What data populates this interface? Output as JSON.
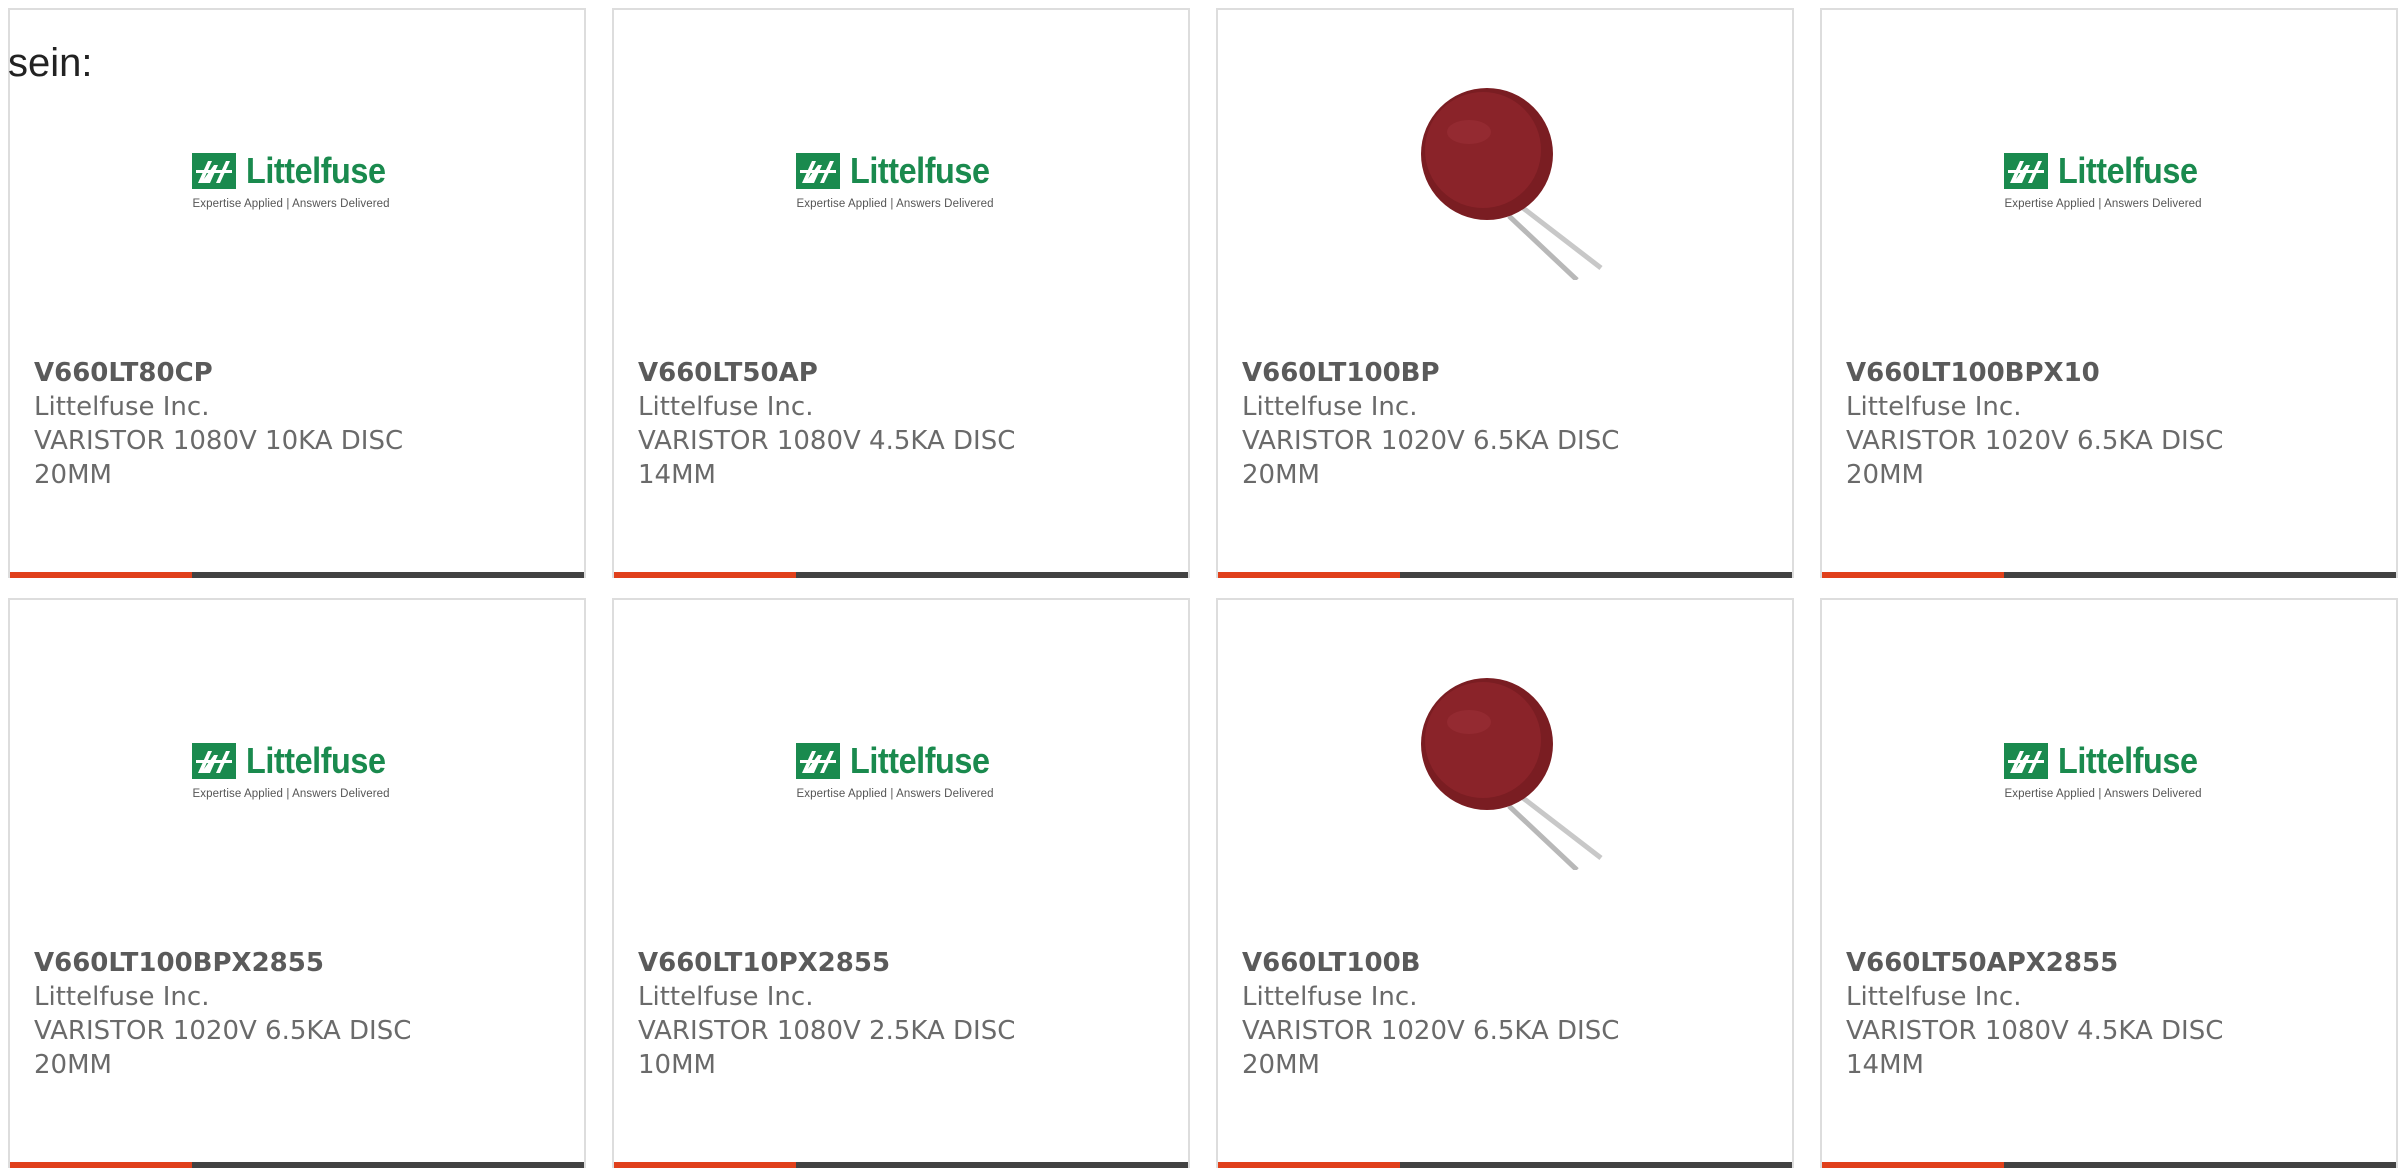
{
  "intro_text": "sein:",
  "logo": {
    "wordmark": "Littelfuse",
    "tagline": "Expertise Applied | Answers Delivered",
    "brand_color": "#1a8a4e"
  },
  "colors": {
    "accent_bar": "#e0401b",
    "bar": "#424242"
  },
  "products": [
    {
      "part": "V660LT80CP",
      "manufacturer": "Littelfuse Inc.",
      "description": "VARISTOR 1080V 10KA DISC 20MM",
      "image": "littelfuse-logo"
    },
    {
      "part": "V660LT50AP",
      "manufacturer": "Littelfuse Inc.",
      "description": "VARISTOR 1080V 4.5KA DISC 14MM",
      "image": "littelfuse-logo"
    },
    {
      "part": "V660LT100BP",
      "manufacturer": "Littelfuse Inc.",
      "description": "VARISTOR 1020V 6.5KA DISC 20MM",
      "image": "varistor-disc-photo"
    },
    {
      "part": "V660LT100BPX10",
      "manufacturer": "Littelfuse Inc.",
      "description": "VARISTOR 1020V 6.5KA DISC 20MM",
      "image": "littelfuse-logo"
    },
    {
      "part": "V660LT100BPX2855",
      "manufacturer": "Littelfuse Inc.",
      "description": "VARISTOR 1020V 6.5KA DISC 20MM",
      "image": "littelfuse-logo"
    },
    {
      "part": "V660LT10PX2855",
      "manufacturer": "Littelfuse Inc.",
      "description": "VARISTOR 1080V 2.5KA DISC 10MM",
      "image": "littelfuse-logo"
    },
    {
      "part": "V660LT100B",
      "manufacturer": "Littelfuse Inc.",
      "description": "VARISTOR 1020V 6.5KA DISC 20MM",
      "image": "varistor-disc-photo"
    },
    {
      "part": "V660LT50APX2855",
      "manufacturer": "Littelfuse Inc.",
      "description": "VARISTOR 1080V 4.5KA DISC 14MM",
      "image": "littelfuse-logo"
    }
  ]
}
